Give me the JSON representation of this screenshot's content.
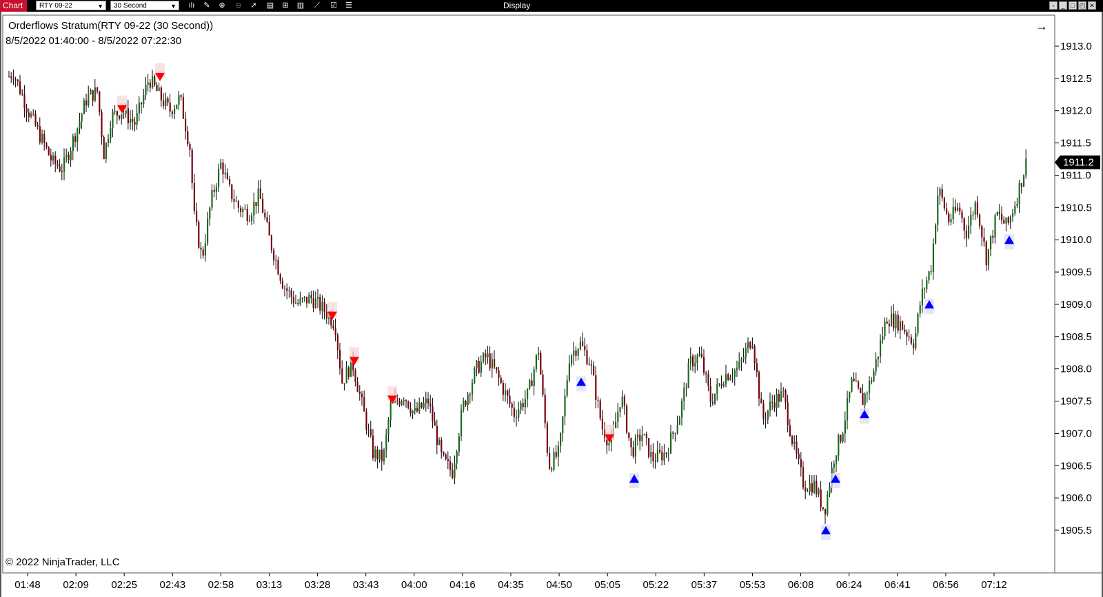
{
  "toolbar": {
    "chart_tab": "Chart",
    "instrument": "RTY 09-22",
    "interval": "30 Second",
    "display": "Display",
    "icons": [
      "bar-type-icon",
      "draw-icon",
      "zoom-in-icon",
      "zoom-out-icon",
      "pointer-icon",
      "properties-icon",
      "template-icon",
      "indicators-icon",
      "strategies-icon",
      "data-box-icon",
      "list-icon"
    ]
  },
  "chart": {
    "title": "Orderflows Stratum(RTY 09-22 (30 Second))",
    "range": "8/5/2022 01:40:00 - 8/5/2022 07:22:30",
    "copyright": "© 2022 NinjaTrader, LLC",
    "last_price": "1911.2"
  },
  "chart_data": {
    "type": "candlestick",
    "price_axis": [
      "1913.0",
      "1912.5",
      "1912.0",
      "1911.5",
      "1911.0",
      "1910.5",
      "1910.0",
      "1909.5",
      "1909.0",
      "1908.5",
      "1908.0",
      "1907.5",
      "1907.0",
      "1906.5",
      "1906.0",
      "1905.5"
    ],
    "time_axis": [
      "01:48",
      "02:09",
      "02:25",
      "02:43",
      "02:58",
      "03:13",
      "03:28",
      "03:43",
      "04:00",
      "04:16",
      "04:35",
      "04:50",
      "05:05",
      "05:22",
      "05:37",
      "05:53",
      "06:08",
      "06:24",
      "06:41",
      "06:56",
      "07:12"
    ],
    "ylim": [
      1905.2,
      1913.4
    ],
    "price_path": [
      [
        0,
        1912.4
      ],
      [
        18,
        1912.6
      ],
      [
        40,
        1912.0
      ],
      [
        75,
        1911.2
      ],
      [
        90,
        1911.1
      ],
      [
        110,
        1911.7
      ],
      [
        125,
        1912.2
      ],
      [
        140,
        1912.3
      ],
      [
        150,
        1911.3
      ],
      [
        160,
        1911.9
      ],
      [
        175,
        1912.0
      ],
      [
        195,
        1911.8
      ],
      [
        215,
        1912.5
      ],
      [
        232,
        1912.2
      ],
      [
        245,
        1912.0
      ],
      [
        260,
        1912.2
      ],
      [
        275,
        1911.4
      ],
      [
        280,
        1910.4
      ],
      [
        292,
        1909.7
      ],
      [
        305,
        1910.6
      ],
      [
        320,
        1911.2
      ],
      [
        330,
        1910.8
      ],
      [
        345,
        1910.5
      ],
      [
        360,
        1910.4
      ],
      [
        375,
        1910.7
      ],
      [
        390,
        1910.0
      ],
      [
        410,
        1909.3
      ],
      [
        430,
        1909.0
      ],
      [
        450,
        1909.1
      ],
      [
        470,
        1908.9
      ],
      [
        485,
        1908.7
      ],
      [
        495,
        1907.8
      ],
      [
        510,
        1908.1
      ],
      [
        525,
        1907.4
      ],
      [
        540,
        1906.7
      ],
      [
        555,
        1906.6
      ],
      [
        565,
        1907.4
      ],
      [
        585,
        1907.6
      ],
      [
        600,
        1907.3
      ],
      [
        620,
        1907.5
      ],
      [
        640,
        1906.6
      ],
      [
        655,
        1906.4
      ],
      [
        670,
        1907.4
      ],
      [
        690,
        1908.0
      ],
      [
        705,
        1908.2
      ],
      [
        720,
        1907.9
      ],
      [
        745,
        1907.3
      ],
      [
        765,
        1907.6
      ],
      [
        780,
        1908.3
      ],
      [
        795,
        1906.5
      ],
      [
        810,
        1906.7
      ],
      [
        825,
        1908.2
      ],
      [
        840,
        1908.4
      ],
      [
        855,
        1908.1
      ],
      [
        872,
        1907.1
      ],
      [
        885,
        1906.8
      ],
      [
        900,
        1907.6
      ],
      [
        915,
        1906.7
      ],
      [
        930,
        1907.0
      ],
      [
        945,
        1906.6
      ],
      [
        965,
        1906.7
      ],
      [
        985,
        1907.3
      ],
      [
        1000,
        1908.1
      ],
      [
        1015,
        1908.2
      ],
      [
        1030,
        1907.5
      ],
      [
        1050,
        1907.9
      ],
      [
        1070,
        1908.0
      ],
      [
        1090,
        1908.5
      ],
      [
        1105,
        1907.2
      ],
      [
        1120,
        1907.5
      ],
      [
        1135,
        1907.6
      ],
      [
        1150,
        1906.8
      ],
      [
        1165,
        1906.2
      ],
      [
        1180,
        1906.2
      ],
      [
        1195,
        1905.8
      ],
      [
        1210,
        1906.7
      ],
      [
        1220,
        1907.0
      ],
      [
        1235,
        1907.8
      ],
      [
        1250,
        1907.5
      ],
      [
        1265,
        1907.9
      ],
      [
        1285,
        1908.8
      ],
      [
        1305,
        1908.7
      ],
      [
        1325,
        1908.4
      ],
      [
        1335,
        1909.1
      ],
      [
        1350,
        1909.6
      ],
      [
        1360,
        1910.8
      ],
      [
        1375,
        1910.3
      ],
      [
        1390,
        1910.5
      ],
      [
        1400,
        1910.1
      ],
      [
        1415,
        1910.6
      ],
      [
        1430,
        1909.7
      ],
      [
        1445,
        1910.4
      ],
      [
        1460,
        1910.2
      ],
      [
        1475,
        1910.7
      ],
      [
        1490,
        1911.3
      ]
    ],
    "signals": [
      {
        "t": 177,
        "price": 1912.0,
        "dir": "down"
      },
      {
        "t": 232,
        "price": 1912.5,
        "dir": "down"
      },
      {
        "t": 482,
        "price": 1908.8,
        "dir": "down"
      },
      {
        "t": 514,
        "price": 1908.1,
        "dir": "down"
      },
      {
        "t": 569,
        "price": 1907.5,
        "dir": "down"
      },
      {
        "t": 884,
        "price": 1906.9,
        "dir": "down"
      },
      {
        "t": 843,
        "price": 1907.8,
        "dir": "up"
      },
      {
        "t": 920,
        "price": 1906.3,
        "dir": "up"
      },
      {
        "t": 1198,
        "price": 1905.5,
        "dir": "up"
      },
      {
        "t": 1212,
        "price": 1906.3,
        "dir": "up"
      },
      {
        "t": 1254,
        "price": 1907.3,
        "dir": "up"
      },
      {
        "t": 1348,
        "price": 1909.0,
        "dir": "up"
      },
      {
        "t": 1464,
        "price": 1910.0,
        "dir": "up"
      }
    ],
    "colors": {
      "up": "#1b6b1b",
      "down": "#7a0010",
      "signal_up": "#0000ff",
      "signal_down": "#ff0000",
      "last_price_bg": "#000000"
    }
  }
}
